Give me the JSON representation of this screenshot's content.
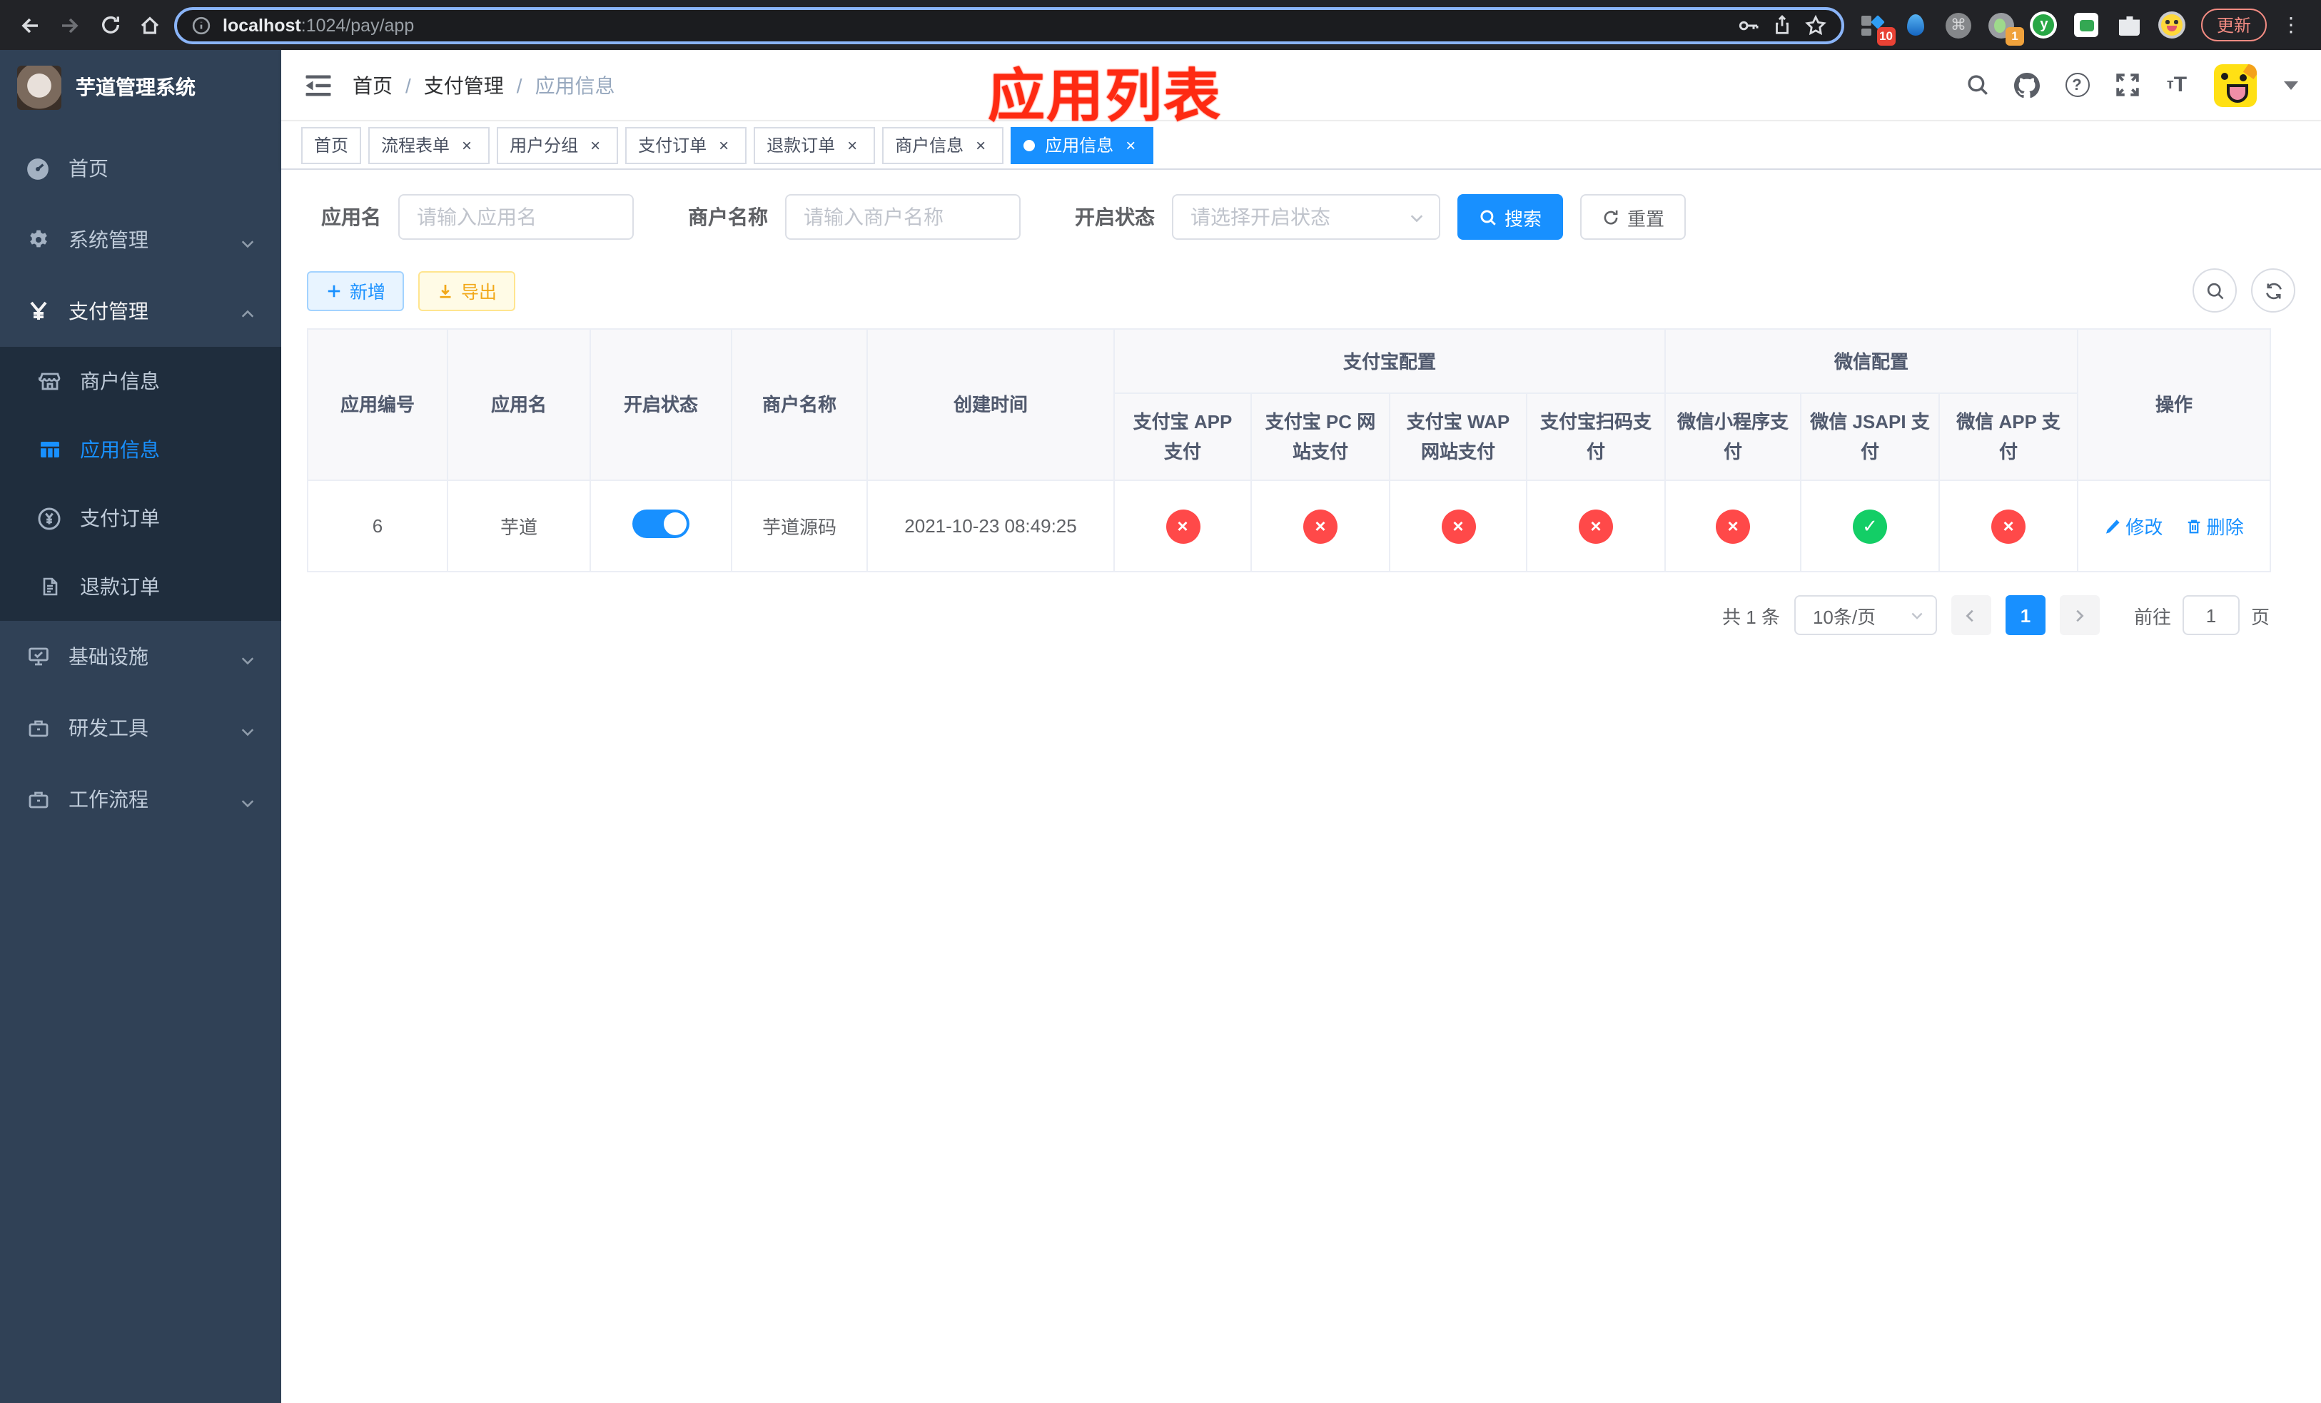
{
  "browser": {
    "url_host": "localhost",
    "url_path": ":1024/pay/app",
    "update_label": "更新",
    "menu_glyph": "⋮",
    "info_glyph": "i",
    "ext_badge_screenshot": "10",
    "ext_badge_recorder": "1",
    "ext_command_glyph": "⌘",
    "ext_y_glyph": "y"
  },
  "sidebar": {
    "title": "芋道管理系统",
    "items": [
      {
        "label": "首页"
      },
      {
        "label": "系统管理"
      },
      {
        "label": "支付管理"
      },
      {
        "label": "基础设施"
      },
      {
        "label": "研发工具"
      },
      {
        "label": "工作流程"
      }
    ],
    "submenu": [
      {
        "label": "商户信息"
      },
      {
        "label": "应用信息"
      },
      {
        "label": "支付订单"
      },
      {
        "label": "退款订单"
      }
    ]
  },
  "navbar": {
    "breadcrumb": [
      "首页",
      "支付管理",
      "应用信息"
    ],
    "separator": "/",
    "help_glyph": "?",
    "fontsize_small": "т",
    "fontsize_big": "T"
  },
  "overlay_title": "应用列表",
  "tabs": [
    {
      "label": "首页"
    },
    {
      "label": "流程表单"
    },
    {
      "label": "用户分组"
    },
    {
      "label": "支付订单"
    },
    {
      "label": "退款订单"
    },
    {
      "label": "商户信息"
    },
    {
      "label": "应用信息"
    }
  ],
  "tab_close_glyph": "×",
  "filters": {
    "name_label": "应用名",
    "name_placeholder": "请输入应用名",
    "merchant_label": "商户名称",
    "merchant_placeholder": "请输入商户名称",
    "status_label": "开启状态",
    "status_placeholder": "请选择开启状态",
    "search_label": "搜索",
    "reset_label": "重置"
  },
  "toolbar": {
    "add_label": "新增",
    "export_label": "导出"
  },
  "table": {
    "group_headers": [
      {
        "label": "支付宝配置"
      },
      {
        "label": "微信配置"
      }
    ],
    "columns": [
      "应用编号",
      "应用名",
      "开启状态",
      "商户名称",
      "创建时间",
      "支付宝 APP 支付",
      "支付宝 PC 网站支付",
      "支付宝 WAP 网站支付",
      "支付宝扫码支付",
      "微信小程序支付",
      "微信 JSAPI 支付",
      "微信 APP 支付",
      "操作"
    ],
    "rows": [
      {
        "id": "6",
        "name": "芋道",
        "enabled": true,
        "merchant_name": "芋道源码",
        "created_at": "2021-10-23 08:49:25",
        "statuses": [
          false,
          false,
          false,
          false,
          false,
          true,
          false
        ],
        "actions": {
          "edit": "修改",
          "delete": "删除"
        }
      }
    ]
  },
  "pagination": {
    "total": "共 1 条",
    "page_size": "10条/页",
    "current_page": "1",
    "goto_label": "前往",
    "goto_value": "1",
    "unit_label": "页"
  },
  "colors": {
    "accent": "#1890ff",
    "danger": "#ff4949",
    "success": "#13ce66",
    "sidebar_bg": "#304156",
    "submenu_bg": "#1f2d3d",
    "annotation_red": "#fe2a12"
  }
}
